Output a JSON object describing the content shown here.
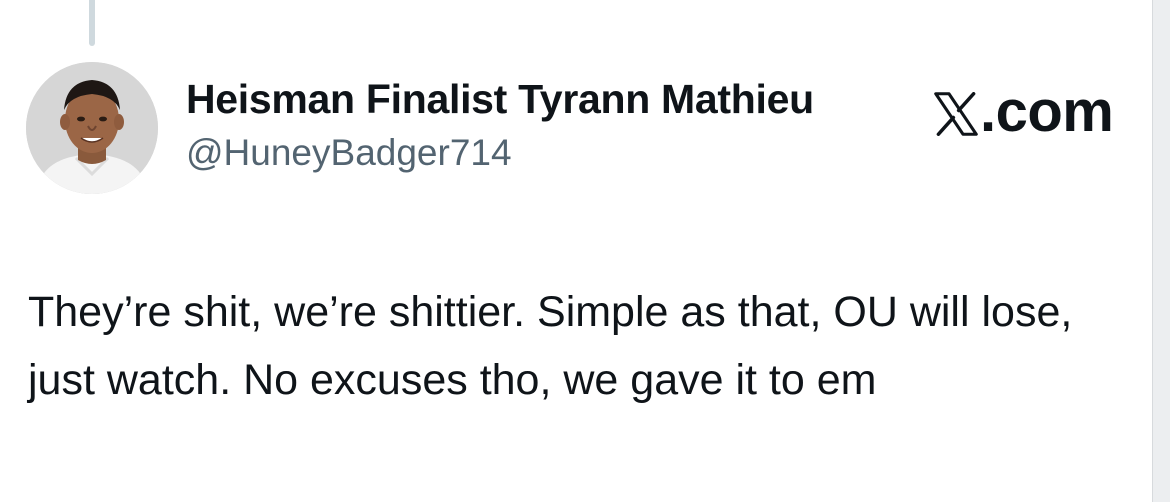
{
  "author": {
    "display_name": "Heisman Finalist Tyrann Mathieu",
    "handle": "@HuneyBadger714",
    "avatar_icon": "profile-photo"
  },
  "branding": {
    "logo_icon": "x-logo-icon",
    "text": ".com"
  },
  "tweet": {
    "text": "They’re shit, we’re shittier. Simple as that, OU will lose, just watch. No excuses tho, we gave it to em"
  },
  "colors": {
    "primary_text": "#0f1419",
    "secondary_text": "#536471",
    "thread_line": "#cfd9de"
  }
}
